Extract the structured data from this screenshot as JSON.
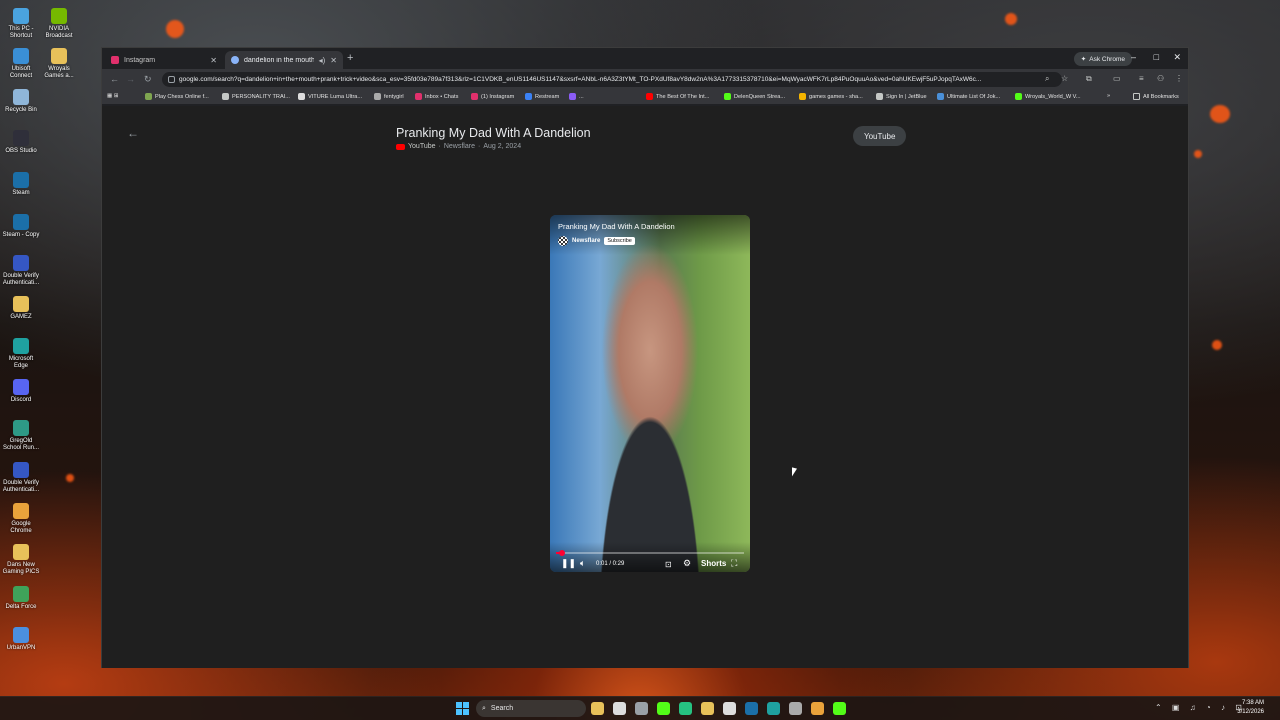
{
  "desktop": {
    "icons": [
      {
        "label": "This PC - Shortcut",
        "color": "#4aa3df"
      },
      {
        "label": "NVIDIA Broadcast",
        "color": "#76b900"
      },
      {
        "label": "Ubisoft Connect",
        "color": "#3a8fd6"
      },
      {
        "label": "Wroyals Games a...",
        "color": "#e8c15a"
      },
      {
        "label": "Recycle Bin",
        "color": "#8fb6d9"
      },
      {
        "label": "OBS Studio",
        "color": "#2f2f3a"
      },
      {
        "label": "Steam",
        "color": "#1b6fa8"
      },
      {
        "label": "Steam - Copy",
        "color": "#1b6fa8"
      },
      {
        "label": "Double Verify Authenticati...",
        "color": "#3557c4"
      },
      {
        "label": "GAMEZ",
        "color": "#e8c15a"
      },
      {
        "label": "Microsoft Edge",
        "color": "#1fa1a0"
      },
      {
        "label": "Discord",
        "color": "#5865f2"
      },
      {
        "label": "GregOld School Run...",
        "color": "#2e9a86"
      },
      {
        "label": "Double Verify Authenticati...",
        "color": "#3557c4"
      },
      {
        "label": "Google Chrome",
        "color": "#e9a23b"
      },
      {
        "label": "Dans New Gaming PICS",
        "color": "#e8c15a"
      },
      {
        "label": "Delta Force",
        "color": "#3fa35a"
      },
      {
        "label": "UrbanVPN",
        "color": "#4b8fe0"
      }
    ]
  },
  "browser": {
    "tabs": [
      {
        "label": "Instagram",
        "active": false,
        "favicon_color": "#e1306c"
      },
      {
        "label": "dandelion in the mouth pr...",
        "active": true,
        "favicon_color": "#8ab4f8"
      }
    ],
    "new_tab_label": "+",
    "ask_chrome": "Ask Chrome",
    "window_controls": {
      "minimize": "–",
      "maximize": "□",
      "close": "✕"
    },
    "url": "google.com/search?q=dandelion+in+the+mouth+prank+trick+video&sca_esv=35fd03e789a7f313&rlz=1C1VDKB_enUS1146US1147&sxsrf=ANbL-n6A3Z3tYMt_TO-PXdUf8avY8dw2nA%3A1773315378710&ei=MqWyacWFK7rLp84PuOquuAo&ved=0ahUKEwjF5uPJopqTAxW6c...",
    "bookmarks": [
      {
        "label": "Play Chess Online f...",
        "color": "#7fa650"
      },
      {
        "label": "PERSONALITY TRAI...",
        "color": "#c4c7c5"
      },
      {
        "label": "VITURE Luma Ultra...",
        "color": "#dddddd"
      },
      {
        "label": "fentygirl",
        "color": "#aaaaaa"
      },
      {
        "label": "Inbox • Chats",
        "color": "#e1306c"
      },
      {
        "label": "(1) Instagram",
        "color": "#e1306c"
      },
      {
        "label": "Restream",
        "color": "#3b82f6"
      },
      {
        "label": "...",
        "color": "#8b5cf6"
      },
      {
        "label": "The Best Of The Int...",
        "color": "#ff0000"
      },
      {
        "label": "DelenQueen Strea...",
        "color": "#53fc18"
      },
      {
        "label": "games games - sha...",
        "color": "#f4b400"
      },
      {
        "label": "Sign In | JetBlue",
        "color": "#c4c7c5"
      },
      {
        "label": "Ultimate List Of Jok...",
        "color": "#4a90d9"
      },
      {
        "label": "Wroyals_World_W V...",
        "color": "#53fc18"
      }
    ],
    "bookmarks_more": "»",
    "all_bookmarks": "All Bookmarks"
  },
  "video_page": {
    "title": "Pranking My Dad With A Dandelion",
    "source": "YouTube",
    "channel": "Newsflare",
    "date": "Aug 2, 2024",
    "youtube_button": "YouTube"
  },
  "player": {
    "title": "Pranking My Dad With A Dandelion",
    "channel": "Newsflare",
    "subscribe_label": "Subscribe",
    "time_display": "0:01 / 0:29",
    "progress_fraction": 0.034,
    "shorts_label": "Shorts"
  },
  "taskbar": {
    "search_label": "Search",
    "time": "7:38 AM",
    "date": "3/12/2026",
    "apps": [
      "#e8c15a",
      "#dddddd",
      "#9aa0a6",
      "#53fc18",
      "#26c281",
      "#e8c15a",
      "#dddddd",
      "#1b6fa8",
      "#1fa1a0",
      "#aaaaaa",
      "#e9a23b",
      "#53fc18"
    ]
  }
}
